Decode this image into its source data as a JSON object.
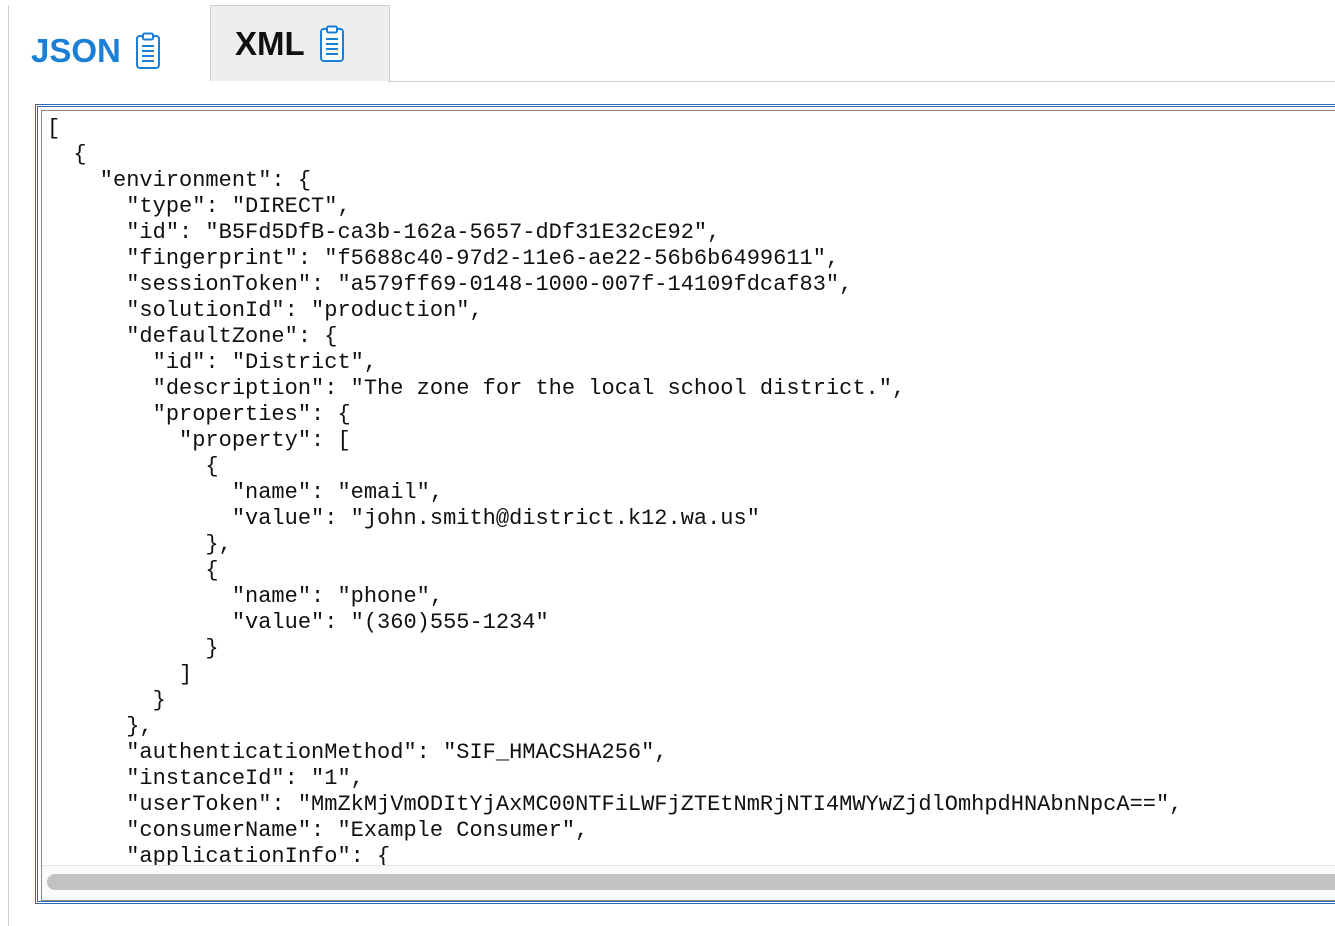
{
  "tabs": [
    {
      "label": "JSON",
      "active": true,
      "icon": "clipboard-icon"
    },
    {
      "label": "XML",
      "active": false,
      "icon": "clipboard-icon"
    }
  ],
  "colors": {
    "active_tab": "#1c7fd6",
    "editor_border": "#2f69b3"
  },
  "editor": {
    "lines": [
      "[",
      "  {",
      "    \"environment\": {",
      "      \"type\": \"DIRECT\",",
      "      \"id\": \"B5Fd5DfB-ca3b-162a-5657-dDf31E32cE92\",",
      "      \"fingerprint\": \"f5688c40-97d2-11e6-ae22-56b6b6499611\",",
      "      \"sessionToken\": \"a579ff69-0148-1000-007f-14109fdcaf83\",",
      "      \"solutionId\": \"production\",",
      "      \"defaultZone\": {",
      "        \"id\": \"District\",",
      "        \"description\": \"The zone for the local school district.\",",
      "        \"properties\": {",
      "          \"property\": [",
      "            {",
      "              \"name\": \"email\",",
      "              \"value\": \"john.smith@district.k12.wa.us\"",
      "            },",
      "            {",
      "              \"name\": \"phone\",",
      "              \"value\": \"(360)555-1234\"",
      "            }",
      "          ]",
      "        }",
      "      },",
      "      \"authenticationMethod\": \"SIF_HMACSHA256\",",
      "      \"instanceId\": \"1\",",
      "      \"userToken\": \"MmZkMjVmODItYjAxMC00NTFiLWFjZTEtNmRjNTI4MWYwZjdlOmhpdHNAbnNpcA==\",",
      "      \"consumerName\": \"Example Consumer\",",
      "      \"applicationInfo\": {"
    ]
  }
}
